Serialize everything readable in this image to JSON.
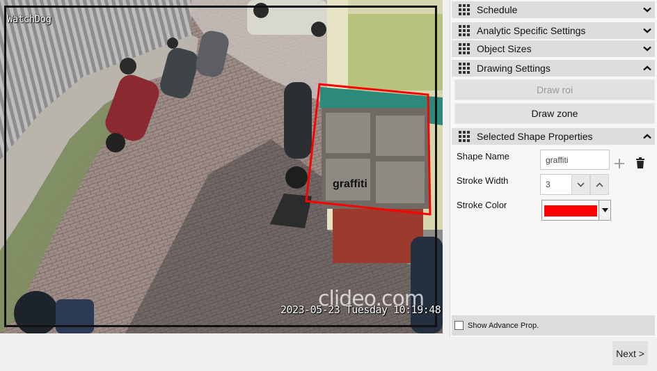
{
  "camera": {
    "channel_label": "WatchDog",
    "timestamp": "2023-05-23 Tuesday 10:19:48",
    "watermark": "clideo.com",
    "zone_label": "graffiti"
  },
  "sections": {
    "schedule": "Schedule",
    "analytic": "Analytic Specific Settings",
    "object_sizes": "Object Sizes",
    "drawing": "Drawing Settings",
    "selected_shape": "Selected Shape Properties"
  },
  "drawing": {
    "draw_roi": "Draw roi",
    "draw_zone": "Draw zone"
  },
  "shape_props": {
    "name_label": "Shape Name",
    "name_value": "graffiti",
    "stroke_width_label": "Stroke Width",
    "stroke_width_value": "3",
    "stroke_color_label": "Stroke Color",
    "stroke_color": "#ff0000"
  },
  "advanced": {
    "label": "Show Advance Prop.",
    "checked": false
  },
  "footer": {
    "next_label": "Next >"
  },
  "icons": {
    "collapse": "chevron-down-icon",
    "expand": "chevron-up-icon",
    "grip": "grip-icon",
    "add": "plus-icon",
    "delete": "trash-icon"
  },
  "colors": {
    "zone_stroke": "#ff0000",
    "section_header": "#dddddd"
  }
}
